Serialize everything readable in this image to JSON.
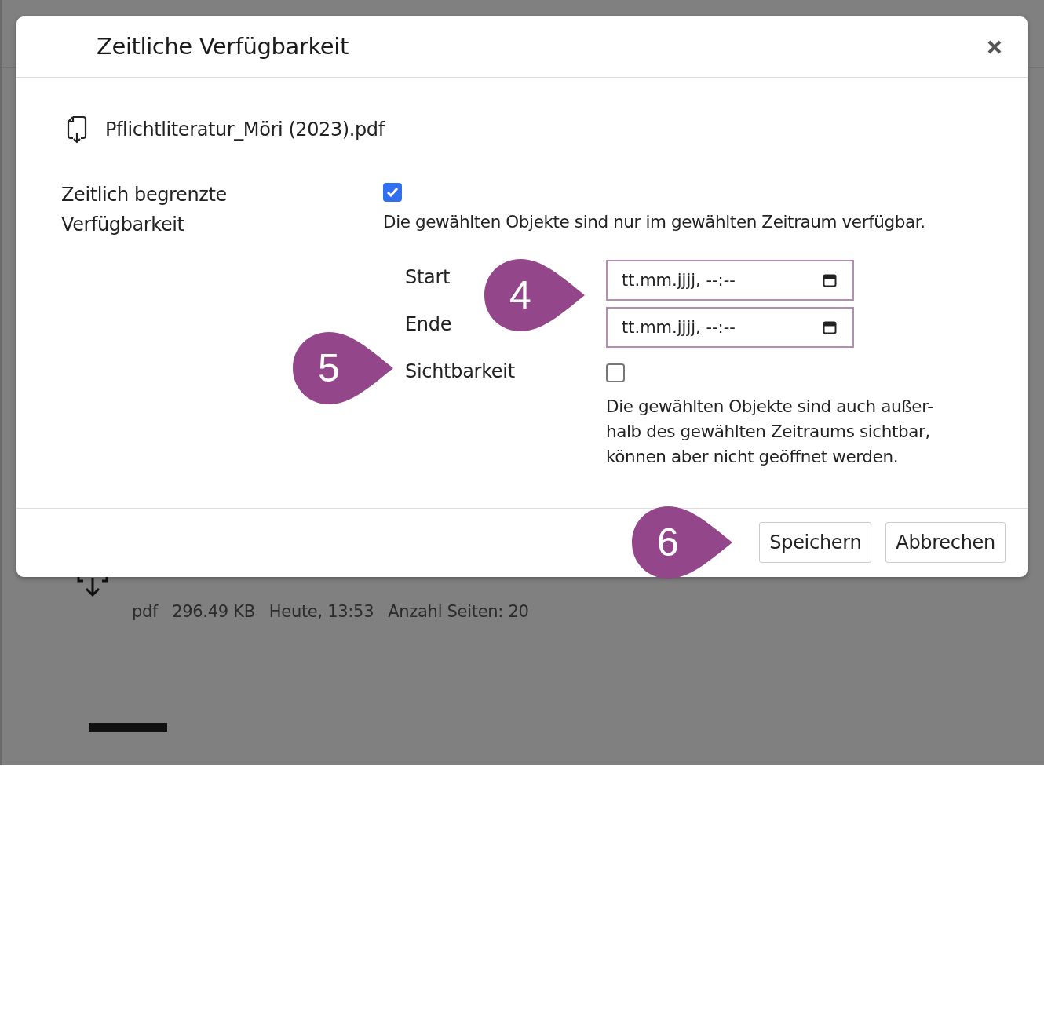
{
  "background": {
    "file_meta": [
      "pdf",
      "296.49 KB",
      "Heute, 13:53",
      "Anzahl Seiten: 20"
    ]
  },
  "dialog": {
    "title": "Zeitliche Verfügbarkeit",
    "file": {
      "name": "Pflichtliteratur_Möri (2023).pdf"
    },
    "limit": {
      "label": "Zeitlich begrenzte Verfügbarkeit",
      "checked": true,
      "hint": "Die gewählten Objekte sind nur im gewählten Zeitraum verfügbar."
    },
    "fields": [
      {
        "label": "Start",
        "kind": "date",
        "value": "tt.mm.jjjj, --:--"
      },
      {
        "label": "Ende",
        "kind": "date",
        "value": "tt.mm.jjjj, --:--"
      },
      {
        "label": "Sichtbarkeit",
        "kind": "checkbox",
        "checked": false,
        "hint": "Die gewählten Objekte sind auch außer-halb des gewählten Zeitraums sichtbar, können aber nicht geöffnet werden."
      }
    ],
    "buttons": [
      "Speichern",
      "Abbrechen"
    ]
  },
  "callouts": [
    {
      "number": "4"
    },
    {
      "number": "5"
    },
    {
      "number": "6"
    }
  ]
}
